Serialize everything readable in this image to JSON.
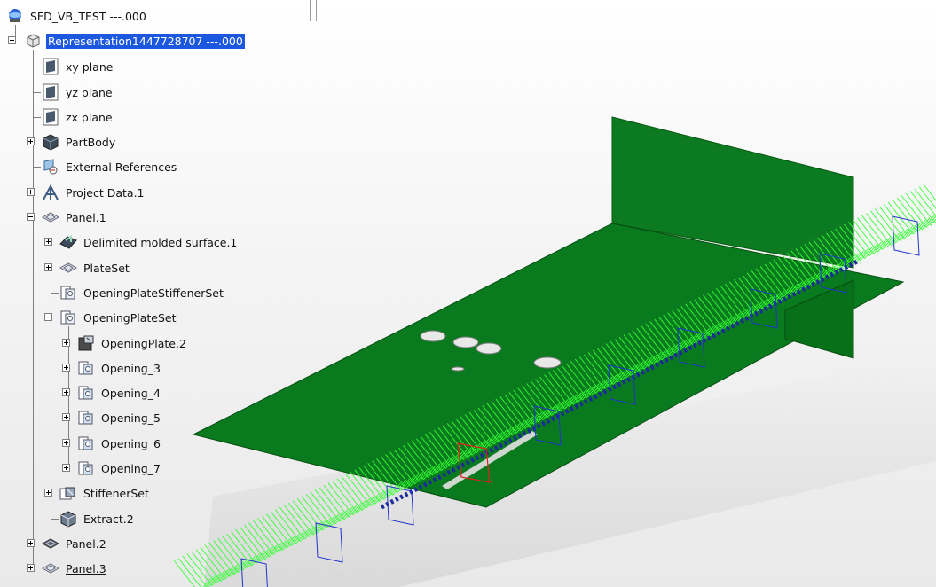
{
  "tree": {
    "root": "SFD_VB_TEST ---.000",
    "representation": "Representation1447728707 ---.000",
    "planes": [
      "xy plane",
      "yz plane",
      "zx plane"
    ],
    "part_body": "PartBody",
    "external_references": "External References",
    "project_data": "Project Data.1",
    "panel1": {
      "label": "Panel.1",
      "delimited_surface": "Delimited molded surface.1",
      "plate_set": "PlateSet",
      "opening_plate_stiffener_set": "OpeningPlateStiffenerSet",
      "opening_plate_set": "OpeningPlateSet",
      "opening_plate": "OpeningPlate.2",
      "openings": [
        "Opening_3",
        "Opening_4",
        "Opening_5",
        "Opening_6",
        "Opening_7"
      ],
      "stiffener_set": "StiffenerSet",
      "extract": "Extract.2"
    },
    "panel2": "Panel.2",
    "panel3": "Panel.3"
  },
  "colors": {
    "selection": "#1c57e0",
    "plate_green": "#0a7a1e",
    "wireframe_green": "#33ff33",
    "stiffener_blue": "#1b2b9a",
    "highlight_red": "#e02020"
  }
}
